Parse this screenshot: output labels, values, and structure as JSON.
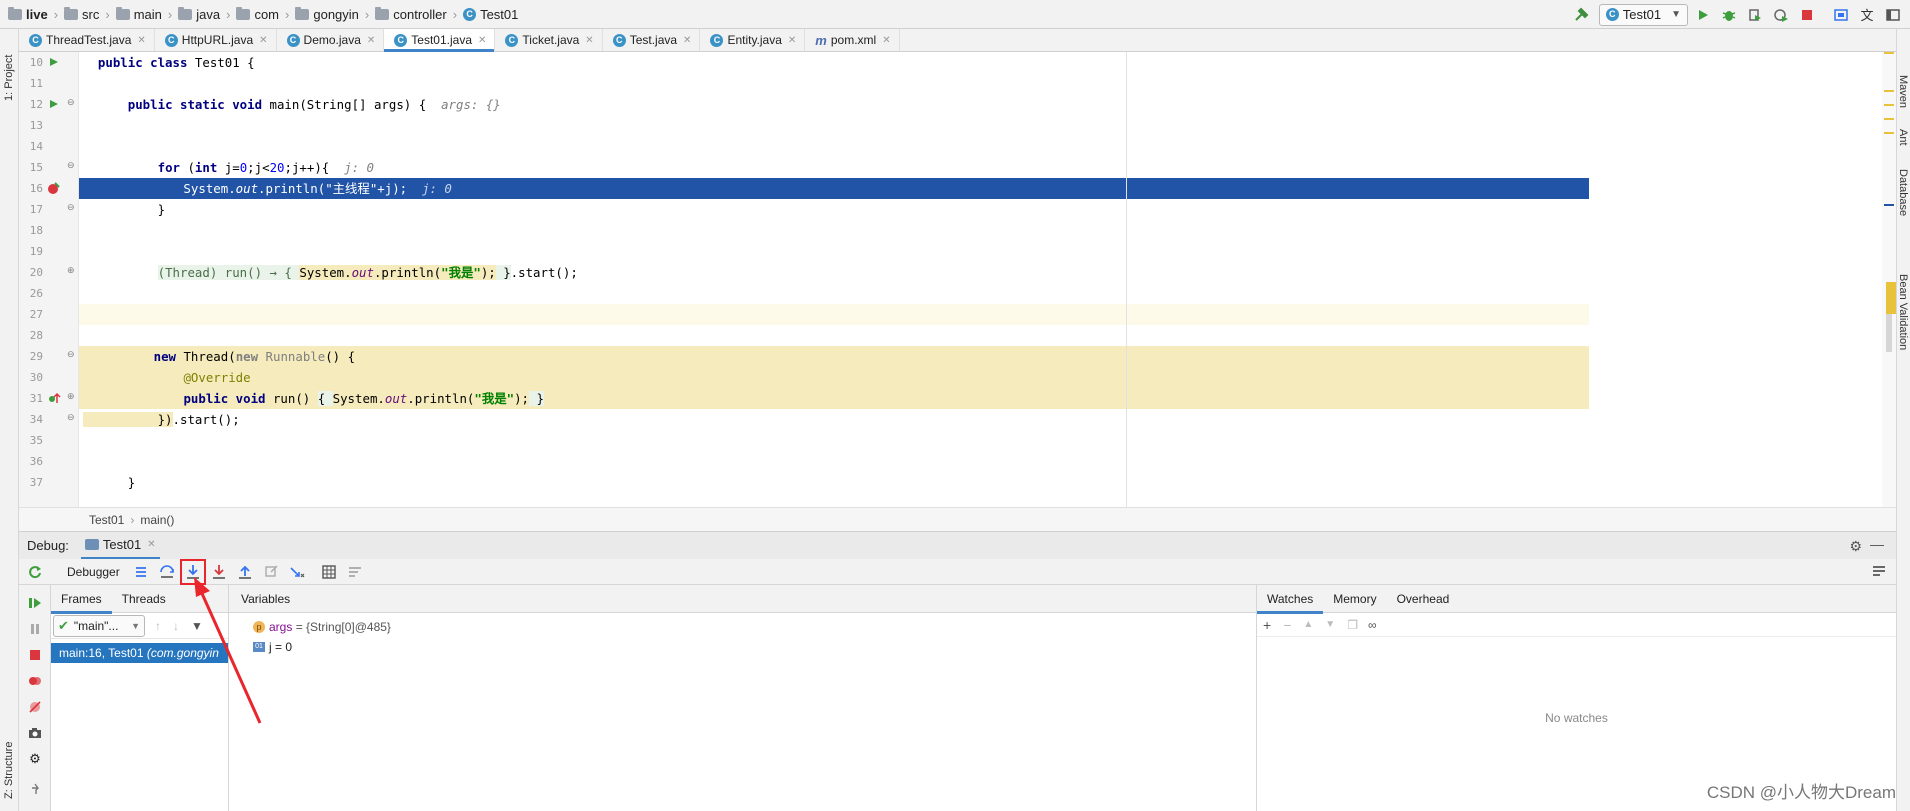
{
  "breadcrumbs": [
    {
      "label": "live",
      "bold": true,
      "icon": "folder-icon"
    },
    {
      "label": "src",
      "icon": "folder-icon"
    },
    {
      "label": "main",
      "icon": "folder-icon"
    },
    {
      "label": "java",
      "icon": "folder-icon"
    },
    {
      "label": "com",
      "icon": "folder-icon"
    },
    {
      "label": "gongyin",
      "icon": "folder-icon"
    },
    {
      "label": "controller",
      "icon": "folder-icon"
    },
    {
      "label": "Test01",
      "icon": "class-icon"
    }
  ],
  "run_config": {
    "selected": "Test01"
  },
  "left_strip": {
    "project_label": "1: Project",
    "structure_label": "Z: Structure"
  },
  "right_strip": {
    "labels": [
      "Maven",
      "Ant",
      "Database",
      "Bean Validation"
    ]
  },
  "tabs": [
    {
      "label": "ThreadTest.java",
      "active": false,
      "icon": "class-icon"
    },
    {
      "label": "HttpURL.java",
      "active": false,
      "icon": "class-icon"
    },
    {
      "label": "Demo.java",
      "active": false,
      "icon": "class-icon"
    },
    {
      "label": "Test01.java",
      "active": true,
      "icon": "class-icon"
    },
    {
      "label": "Ticket.java",
      "active": false,
      "icon": "class-icon"
    },
    {
      "label": "Test.java",
      "active": false,
      "icon": "class-icon"
    },
    {
      "label": "Entity.java",
      "active": false,
      "icon": "class-icon"
    },
    {
      "label": "pom.xml",
      "active": false,
      "icon": "maven-icon"
    }
  ],
  "editor": {
    "line_numbers": [
      "10",
      "11",
      "12",
      "13",
      "14",
      "15",
      "16",
      "17",
      "18",
      "19",
      "20",
      "26",
      "27",
      "28",
      "29",
      "30",
      "31",
      "34",
      "35",
      "36",
      "37"
    ],
    "current_line": "16",
    "hints": {
      "main_args": "args: {}",
      "loop_j": "j: 0",
      "println_j": "j: 0"
    },
    "strings": {
      "main_thread": "\"主线程\"",
      "wo_shi": "\"我是\""
    }
  },
  "editor_breadcrumb": [
    "Test01",
    "main()"
  ],
  "debug": {
    "title": "Debug:",
    "session_tab": "Test01",
    "debugger_label": "Debugger",
    "frames_tab": "Frames",
    "threads_tab": "Threads",
    "thread_select": "\"main\"...",
    "frame_item": "main:16, Test01",
    "frame_item_pkg": "(com.gongyin",
    "variables_label": "Variables",
    "variables": [
      {
        "badge": "p",
        "name": "args",
        "value": "= {String[0]@485}"
      },
      {
        "badge": "01",
        "name": "j",
        "value": "= 0"
      }
    ],
    "watches_tab": "Watches",
    "memory_tab": "Memory",
    "overhead_tab": "Overhead",
    "no_watches": "No watches"
  },
  "watermark": "CSDN @小人物大Dream",
  "colors": {
    "accent": "#4083c9",
    "exec_line": "#2154a6",
    "highlight_box": "#e8262b"
  }
}
